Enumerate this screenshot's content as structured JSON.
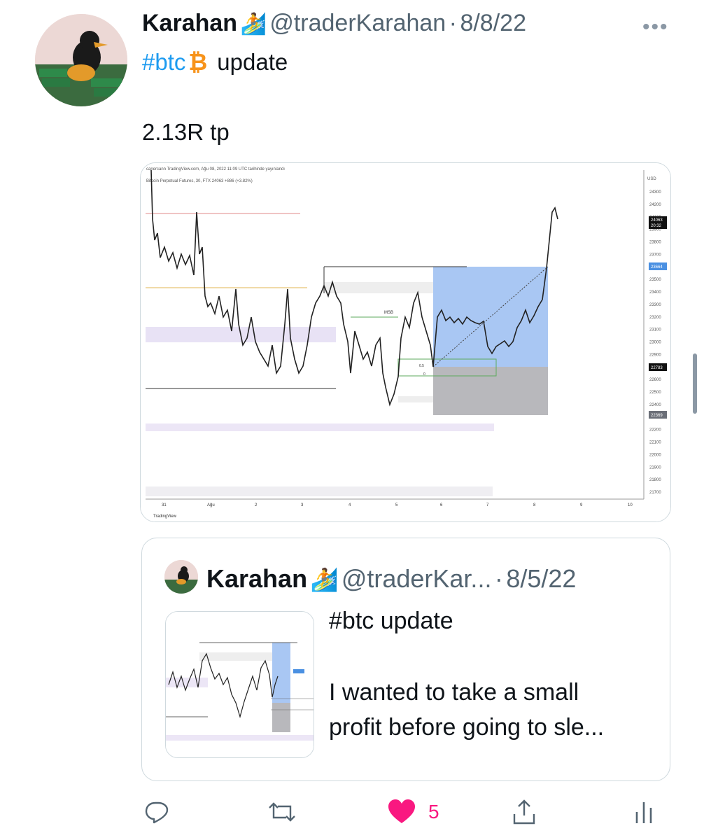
{
  "tweet": {
    "author_name": "Karahan",
    "author_emoji": "🏄",
    "handle": "@traderKarahan",
    "separator": "·",
    "date": "8/8/22",
    "more_label": "•••",
    "hashtag": "#btc",
    "coin_symbol": "₿",
    "line1_rest": "update",
    "line2": "2.13R tp"
  },
  "chart": {
    "header_line1": "canercann TradingView.com, Ağu 08, 2022 11:09 UTC tarihinde yayınlandı",
    "header_line2": "Bitcoin Perpetual Futures, 30, FTX  24063  +886 (+3.82%)",
    "currency": "USD",
    "price_ticks": [
      "24300",
      "24200",
      "24100",
      "23900",
      "23800",
      "23700",
      "23600",
      "23500",
      "23400",
      "23300",
      "23200",
      "23100",
      "23000",
      "22900",
      "22700",
      "22600",
      "22500",
      "22400",
      "22300",
      "22200",
      "22100",
      "22000",
      "21900",
      "21800",
      "21700"
    ],
    "last_price": "24063",
    "last_time": "20:32",
    "marker_blue": "23664",
    "marker_dark": "22783",
    "marker_gray": "22369",
    "x_ticks": [
      "31",
      "Ağu",
      "2",
      "3",
      "4",
      "5",
      "6",
      "7",
      "8",
      "9",
      "10"
    ],
    "msb_label": "MSB",
    "fib_label_1": "0.5",
    "fib_label_2": "0",
    "footer": "TradingView"
  },
  "quote": {
    "author_name": "Karahan",
    "author_emoji": "🏄",
    "handle": "@traderKar...",
    "separator": "·",
    "date": "8/5/22",
    "line1": "#btc update",
    "line2": "I wanted to take a small",
    "line3": "profit before going to sle..."
  },
  "actions": {
    "likes": "5"
  },
  "colors": {
    "link": "#1d9bf0",
    "like": "#f91880",
    "muted": "#536471"
  }
}
